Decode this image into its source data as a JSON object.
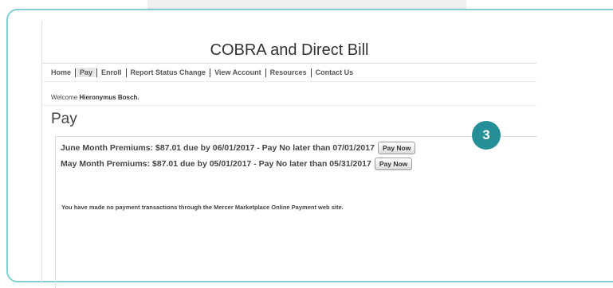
{
  "site": {
    "title": "COBRA and Direct Bill"
  },
  "nav": {
    "items": [
      {
        "label": "Home"
      },
      {
        "label": "Pay"
      },
      {
        "label": "Enroll"
      },
      {
        "label": "Report Status Change"
      },
      {
        "label": "View Account"
      },
      {
        "label": "Resources"
      },
      {
        "label": "Contact Us"
      }
    ],
    "active": "Pay"
  },
  "welcome": {
    "prefix": "Welcome",
    "user_name": "Hieronymus Bosch."
  },
  "page": {
    "heading": "Pay"
  },
  "premiums": [
    {
      "text": "June Month Premiums: $87.01 due by 06/01/2017 - Pay No later than 07/01/2017",
      "button_label": "Pay Now"
    },
    {
      "text": "May Month Premiums: $87.01 due by 05/01/2017 - Pay No later than 05/31/2017",
      "button_label": "Pay Now"
    }
  ],
  "transactions": {
    "message": "You have made no payment transactions through the Mercer Marketplace Online Payment web site."
  },
  "callout": {
    "step": "3",
    "color": "#248f96"
  }
}
